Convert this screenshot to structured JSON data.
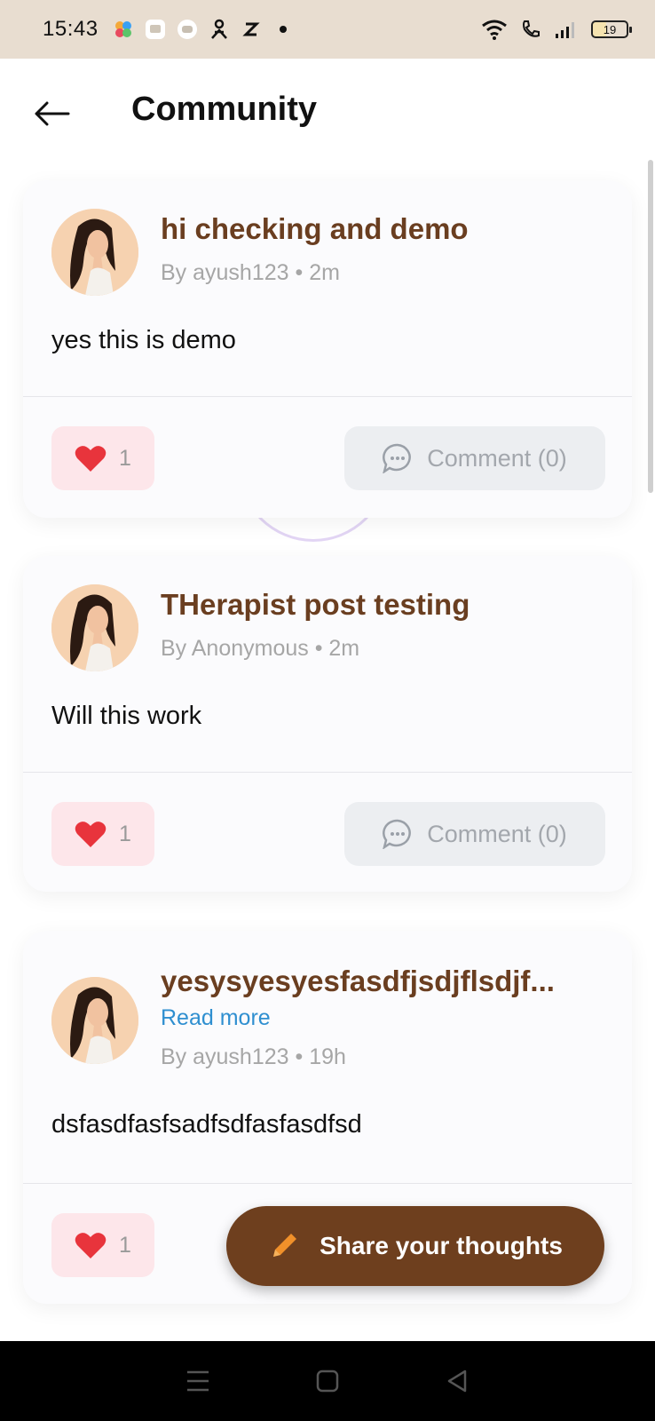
{
  "status_bar": {
    "time": "15:43",
    "battery": "19",
    "left_icons": [
      "flower-app-icon",
      "tv-app-icon",
      "chat-app-icon",
      "person-app-icon",
      "z-app-icon",
      "dot-icon"
    ],
    "right_icons": [
      "wifi-icon",
      "call-icon",
      "signal-icon",
      "battery-icon"
    ]
  },
  "header": {
    "title": "Community",
    "back_icon": "arrow-left-icon"
  },
  "posts": [
    {
      "title": "hi checking and demo",
      "meta": "By ayush123 • 2m",
      "body": "yes this is demo",
      "likes": "1",
      "comment_label": "Comment (0)",
      "read_more": ""
    },
    {
      "title": "THerapist post testing",
      "meta": "By Anonymous • 2m",
      "body": "Will this work",
      "likes": "1",
      "comment_label": "Comment (0)",
      "read_more": ""
    },
    {
      "title": "yesysyesyesfasdfjsdjflsdjf...",
      "meta": "By ayush123 • 19h",
      "body": "dsfasdfasfsadfsdfasfasdfsd",
      "likes": "1",
      "comment_label": "",
      "read_more": "Read more"
    }
  ],
  "fab": {
    "label": "Share your thoughts",
    "icon": "pencil-icon"
  },
  "colors": {
    "title_brown": "#6a3e20",
    "fab_brown": "#6e3f1e",
    "heart_red": "#e8343c",
    "link_blue": "#2f8fd0",
    "status_bar_bg": "#e8ddd0"
  }
}
